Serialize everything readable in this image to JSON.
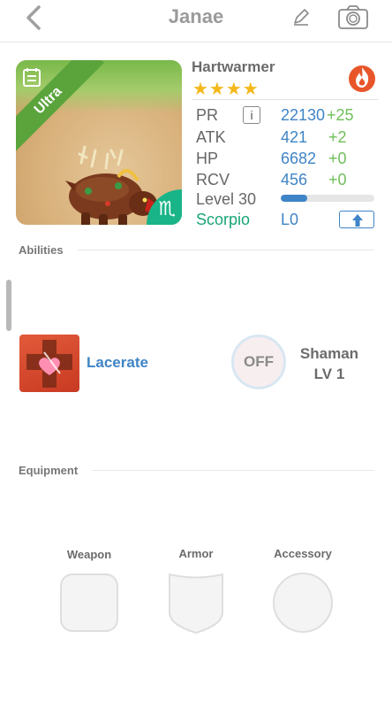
{
  "header": {
    "title": "Janae",
    "back_icon": "chevron-left-icon",
    "edit_icon": "pencil-icon",
    "camera_icon": "camera-icon"
  },
  "monster": {
    "name": "Hartwarmer",
    "rarity": "Ultra",
    "stars": "★★★★",
    "element_icon": "fire-icon",
    "sign_glyph": "♏",
    "stats": [
      {
        "label": "PR",
        "value": "22130",
        "bonus": "+25"
      },
      {
        "label": "ATK",
        "value": "421",
        "bonus": "+2"
      },
      {
        "label": "HP",
        "value": "6682",
        "bonus": "+0"
      },
      {
        "label": "RCV",
        "value": "456",
        "bonus": "+0"
      }
    ],
    "info_label": "i",
    "level_label": "Level 30",
    "level_progress": 0.28,
    "sign_name": "Scorpio",
    "sign_level": "L0"
  },
  "abilities": {
    "section_label": "Abilities",
    "ability_name": "Lacerate",
    "toggle_label": "OFF",
    "class_name": "Shaman",
    "class_level": "LV 1"
  },
  "equipment": {
    "section_label": "Equipment",
    "slots": [
      {
        "label": "Weapon"
      },
      {
        "label": "Armor"
      },
      {
        "label": "Accessory"
      }
    ]
  },
  "colors": {
    "accent_blue": "#3f84c6",
    "bonus_green": "#6fbf5a",
    "scorpio_green": "#19a577",
    "ultra_green": "#5aa43b",
    "star_gold": "#f5b81a"
  }
}
